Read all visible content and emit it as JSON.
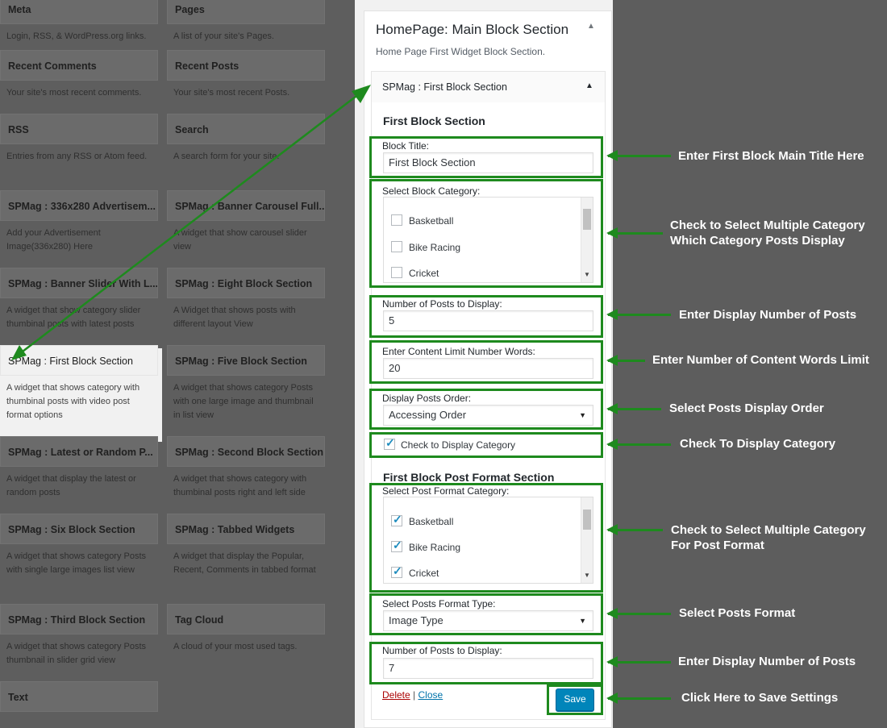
{
  "left_widgets": [
    {
      "title": "Meta",
      "desc": "Login, RSS, & WordPress.org links."
    },
    {
      "title": "Pages",
      "desc": "A list of your site's Pages."
    },
    {
      "title": "Recent Comments",
      "desc": "Your site's most recent comments."
    },
    {
      "title": "Recent Posts",
      "desc": "Your site's most recent Posts."
    },
    {
      "title": "RSS",
      "desc": "Entries from any RSS or Atom feed."
    },
    {
      "title": "Search",
      "desc": "A search form for your site."
    },
    {
      "title": "SPMag : 336x280 Advertisem...",
      "desc": "Add your Advertisement Image(336x280) Here"
    },
    {
      "title": "SPMag : Banner Carousel Full...",
      "desc": "A widget that show carousel slider view"
    },
    {
      "title": "SPMag : Banner Slider With L...",
      "desc": "A widget that show category slider thumbinal posts with latest posts"
    },
    {
      "title": "SPMag : Eight Block Section",
      "desc": "A Widget that shows posts with different layout View"
    },
    {
      "title": "SPMag : First Block Section",
      "desc": "A widget that shows category with thumbinal posts with video post format options"
    },
    {
      "title": "SPMag : Five Block Section",
      "desc": "A widget that shows category Posts with one large image and thumbnail in list view"
    },
    {
      "title": "SPMag : Latest or Random P...",
      "desc": "A widget that display the latest or random posts"
    },
    {
      "title": "SPMag : Second Block Section",
      "desc": "A widget that shows category with thumbinal posts right and left side"
    },
    {
      "title": "SPMag : Six Block Section",
      "desc": "A widget that shows category Posts with single large images list view"
    },
    {
      "title": "SPMag : Tabbed Widgets",
      "desc": "A widget that display the Popular, Recent, Comments in tabbed format"
    },
    {
      "title": "SPMag : Third Block Section",
      "desc": "A widget that shows category Posts thumbnail in slider grid view"
    },
    {
      "title": "Tag Cloud",
      "desc": "A cloud of your most used tags."
    },
    {
      "title": "Text",
      "desc": ""
    }
  ],
  "area": {
    "title": "HomePage: Main Block Section",
    "desc": "Home Page First Widget Block Section.",
    "collapse_icon": "triangle-up-icon"
  },
  "widget": {
    "header": "SPMag : First Block Section",
    "section_title": "First Block Section",
    "block_title_label": "Block Title:",
    "block_title_value": "First Block Section",
    "category_label": "Select Block Category:",
    "categories": [
      {
        "label": "Basketball",
        "checked": false
      },
      {
        "label": "Bike Racing",
        "checked": false
      },
      {
        "label": "Cricket",
        "checked": false
      }
    ],
    "num_posts_label": "Number of Posts to Display:",
    "num_posts_value": "5",
    "content_limit_label": "Enter Content Limit Number Words:",
    "content_limit_value": "20",
    "order_label": "Display Posts Order:",
    "order_value": "Accessing Order",
    "display_category_label": "Check to Display Category",
    "display_category_checked": true,
    "format_section_title": "First Block Post Format Section",
    "format_category_label": "Select Post Format Category:",
    "format_categories": [
      {
        "label": "Basketball",
        "checked": true
      },
      {
        "label": "Bike Racing",
        "checked": true
      },
      {
        "label": "Cricket",
        "checked": true
      }
    ],
    "format_type_label": "Select Posts Format Type:",
    "format_type_value": "Image Type",
    "format_num_label": "Number of Posts to Display:",
    "format_num_value": "7",
    "delete_label": "Delete",
    "separator": "|",
    "close_label": "Close",
    "save_label": "Save"
  },
  "annotations": {
    "a1": "Enter First Block Main Title Here",
    "a2_line1": "Check to Select Multiple Category",
    "a2_line2": "Which Category Posts Display",
    "a3": "Enter Display Number of Posts",
    "a4": "Enter Number of Content Words Limit",
    "a5": "Select Posts Display Order",
    "a6": "Check To Display Category",
    "a7_line1": "Check to Select Multiple Category",
    "a7_line2": "For Post Format",
    "a8": "Select Posts Format",
    "a9": "Enter Display Number of Posts",
    "a10": "Click Here to Save Settings"
  },
  "colors": {
    "annotation_green": "#1e8a1e",
    "save_blue": "#0085ba",
    "link_red": "#a00",
    "link_blue": "#0073aa"
  }
}
